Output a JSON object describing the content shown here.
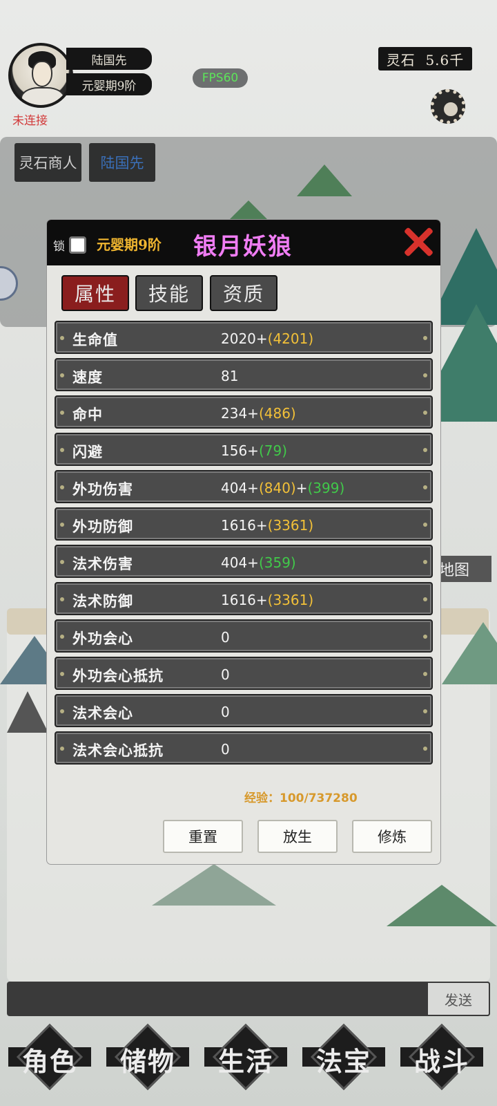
{
  "player": {
    "name": "陆国先",
    "realm": "元婴期9阶",
    "connection_status": "未连接"
  },
  "fps": "FPS60",
  "currency": {
    "label": "灵石",
    "value": "5.6千"
  },
  "top_tabs": [
    "灵石商人",
    "陆国先"
  ],
  "map_label": "地图",
  "modal": {
    "lock_label": "锁",
    "pet_realm": "元婴期9阶",
    "pet_name": "银月妖狼",
    "tabs": [
      "属性",
      "技能",
      "资质"
    ],
    "stats": [
      {
        "name": "生命值",
        "base": "2020+",
        "bonus1": "(4201)",
        "bonus1_color": "yellow"
      },
      {
        "name": "速度",
        "base": "81"
      },
      {
        "name": "命中",
        "base": "234+",
        "bonus1": "(486)",
        "bonus1_color": "yellow"
      },
      {
        "name": "闪避",
        "base": "156+",
        "bonus1": "(79)",
        "bonus1_color": "green"
      },
      {
        "name": "外功伤害",
        "base": "404+",
        "bonus1": "(840)",
        "bonus1_color": "yellow",
        "sep": "+",
        "bonus2": "(399)",
        "bonus2_color": "green"
      },
      {
        "name": "外功防御",
        "base": "1616+",
        "bonus1": "(3361)",
        "bonus1_color": "yellow"
      },
      {
        "name": "法术伤害",
        "base": "404+",
        "bonus1": "(359)",
        "bonus1_color": "green"
      },
      {
        "name": "法术防御",
        "base": "1616+",
        "bonus1": "(3361)",
        "bonus1_color": "yellow"
      },
      {
        "name": "外功会心",
        "base": "0"
      },
      {
        "name": "外功会心抵抗",
        "base": "0"
      },
      {
        "name": "法术会心",
        "base": "0"
      },
      {
        "name": "法术会心抵抗",
        "base": "0"
      }
    ],
    "exp_text": "经验：100/737280",
    "buttons": {
      "reset": "重置",
      "release": "放生",
      "cultivate": "修炼"
    }
  },
  "chat": {
    "send_label": "发送"
  },
  "bottom_nav": [
    "角色",
    "储物",
    "生活",
    "法宝",
    "战斗"
  ],
  "colors": {
    "yellow": "#f2c038",
    "green": "#41c94a",
    "active_tab": "#8a1e1e",
    "pet_name": "#f07df4",
    "realm": "#f0b630"
  }
}
